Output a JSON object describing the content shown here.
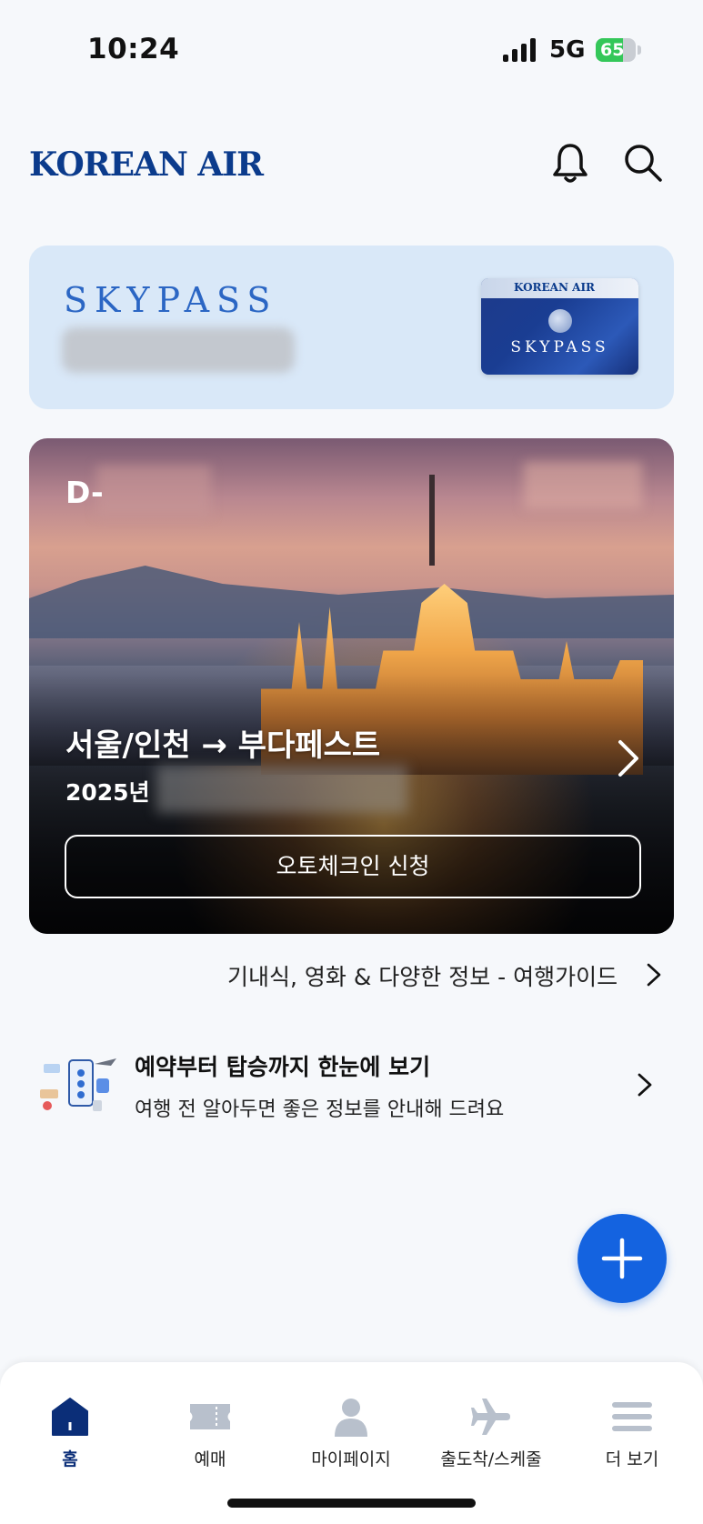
{
  "status_bar": {
    "time": "10:24",
    "network": "5G",
    "battery": "65"
  },
  "header": {
    "logo": "KOREAN AIR",
    "icons": [
      "bell-icon",
      "search-icon"
    ]
  },
  "skypass": {
    "title": "SKYPASS",
    "card_logo": "KOREAN AIR",
    "card_title": "SKYPASS"
  },
  "trip": {
    "dday_prefix": "D-",
    "route": "서울/인천 → 부다페스트",
    "year": "2025년",
    "checkin_label": "오토체크인 신청"
  },
  "guide_link": "기내식, 영화 & 다양한 정보 - 여행가이드",
  "info": {
    "title": "예약부터 탑승까지 한눈에 보기",
    "subtitle": "여행 전 알아두면 좋은 정보를 안내해 드려요"
  },
  "nav": {
    "items": [
      {
        "label": "홈",
        "icon": "home-icon",
        "active": true
      },
      {
        "label": "예매",
        "icon": "ticket-icon",
        "active": false
      },
      {
        "label": "마이페이지",
        "icon": "person-icon",
        "active": false
      },
      {
        "label": "출도착/스케줄",
        "icon": "airplane-icon",
        "active": false
      },
      {
        "label": "더 보기",
        "icon": "menu-icon",
        "active": false
      }
    ]
  },
  "colors": {
    "brand_blue": "#0b3b8c",
    "fab_blue": "#1463e0",
    "skypass_bg": "#d9e8f8"
  }
}
